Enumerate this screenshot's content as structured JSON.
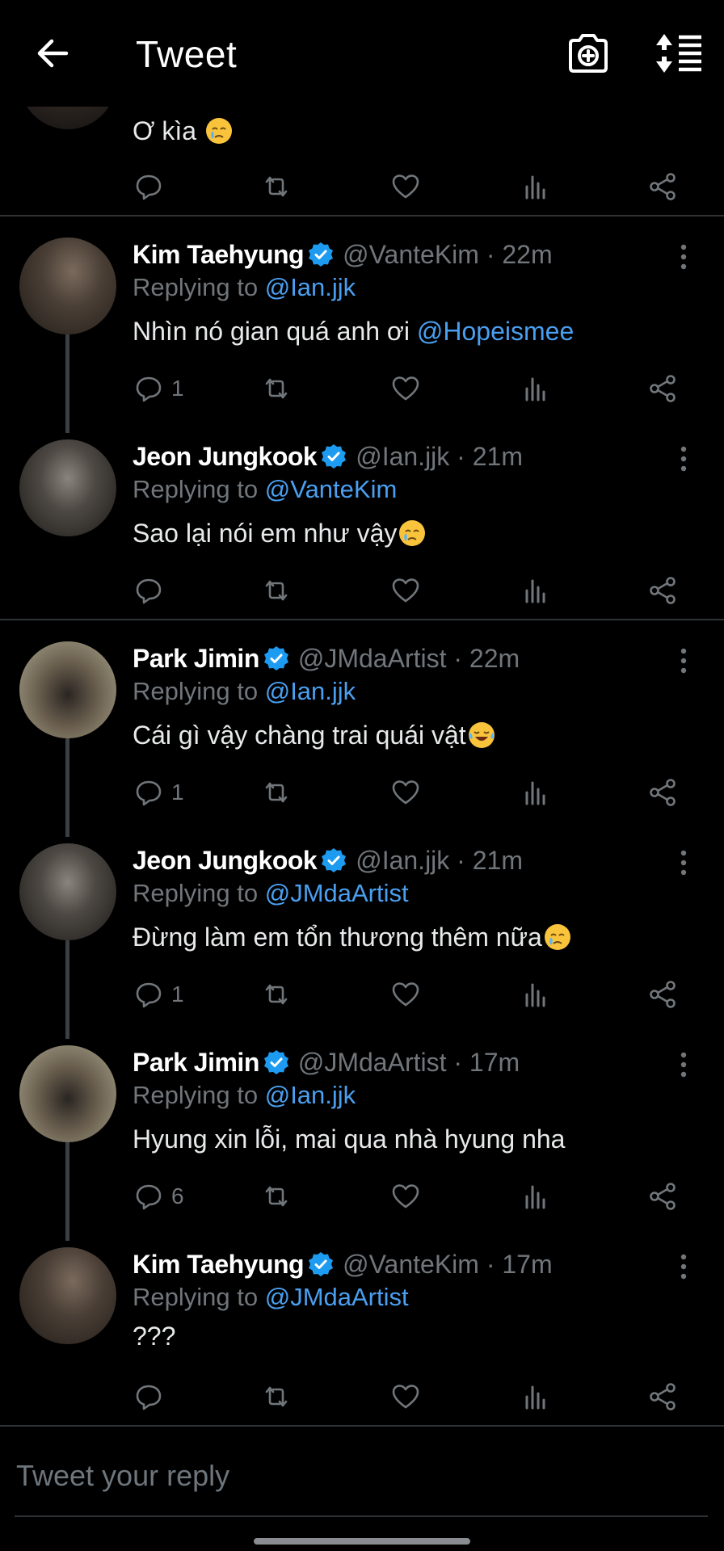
{
  "header": {
    "title": "Tweet",
    "back_icon": "arrow-left-icon",
    "camera_icon": "camera-plus-icon",
    "sort_icon": "sort-replies-icon"
  },
  "partial_tweet": {
    "text": "Ơ kìa",
    "emoji": "crying-face-emoji"
  },
  "tweets": [
    {
      "name": "Kim Taehyung",
      "handle": "@VanteKim",
      "time": "· 22m",
      "replying_label": "Replying to",
      "replying_to": "@Ian.jjk",
      "text": "Nhìn nó gian quá anh ơi",
      "text_mention": "@Hopeismee",
      "reply_count": "1"
    },
    {
      "name": "Jeon Jungkook",
      "handle": "@Ian.jjk",
      "time": "· 21m",
      "replying_label": "Replying to",
      "replying_to": "@VanteKim",
      "text": "Sao lại nói em như vậy",
      "emoji": "crying-face-emoji",
      "reply_count": ""
    },
    {
      "name": "Park Jimin",
      "handle": "@JMdaArtist",
      "time": "· 22m",
      "replying_label": "Replying to",
      "replying_to": "@Ian.jjk",
      "text": "Cái gì vậy chàng trai quái vật",
      "emoji": "tears-of-joy-emoji",
      "reply_count": "1"
    },
    {
      "name": "Jeon Jungkook",
      "handle": "@Ian.jjk",
      "time": "· 21m",
      "replying_label": "Replying to",
      "replying_to": "@JMdaArtist",
      "text": "Đừng làm em tổn thương thêm nữa",
      "emoji": "crying-face-emoji",
      "reply_count": "1"
    },
    {
      "name": "Park Jimin",
      "handle": "@JMdaArtist",
      "time": "· 17m",
      "replying_label": "Replying to",
      "replying_to": "@Ian.jjk",
      "text": "Hyung xin lỗi, mai qua nhà hyung nha",
      "reply_count": "6"
    },
    {
      "name": "Kim Taehyung",
      "handle": "@VanteKim",
      "time": "· 17m",
      "replying_label": "Replying to",
      "replying_to": "@JMdaArtist",
      "text": "???",
      "reply_count": ""
    }
  ],
  "reply_bar": {
    "placeholder": "Tweet your reply"
  },
  "colors": {
    "background": "#000000",
    "accent": "#4a9ff0",
    "secondary_text": "#71767b",
    "verified": "#1d9bf0"
  }
}
